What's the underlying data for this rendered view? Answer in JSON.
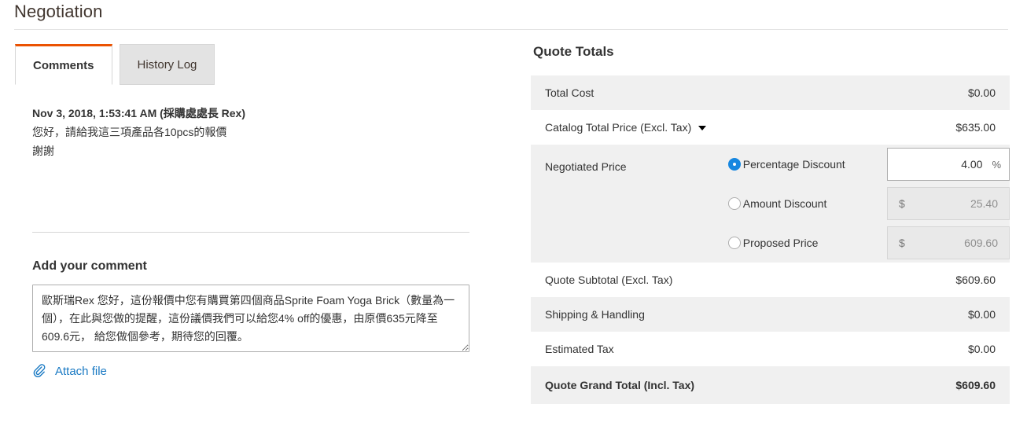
{
  "page": {
    "title": "Negotiation"
  },
  "tabs": [
    {
      "label": "Comments",
      "active": true
    },
    {
      "label": "History Log",
      "active": false
    }
  ],
  "comment": {
    "meta": "Nov 3, 2018, 1:53:41 AM (採購處處長 Rex)",
    "line1": "您好，請給我這三項產品各10pcs的報價",
    "line2": "謝謝"
  },
  "add_comment": {
    "heading": "Add your comment",
    "value": "歐斯瑞Rex 您好，這份報價中您有購買第四個商品Sprite Foam Yoga Brick（數量為一個），在此與您做的提醒，這份議價我們可以給您4% off的優惠，由原價635元降至609.6元， 給您做個參考，期待您的回覆。",
    "placeholder": "",
    "attach_label": "Attach file",
    "attach_icon": "paperclip-icon"
  },
  "totals": {
    "title": "Quote Totals",
    "rows": [
      {
        "label": "Total Cost",
        "value": "$0.00"
      },
      {
        "label": "Catalog Total Price (Excl. Tax)",
        "value": "$635.00",
        "caret": "chevron-down-icon"
      },
      {
        "label": "Quote Subtotal (Excl. Tax)",
        "value": "$609.60"
      },
      {
        "label": "Shipping & Handling",
        "value": "$0.00"
      },
      {
        "label": "Estimated Tax",
        "value": "$0.00"
      },
      {
        "label": "Quote Grand Total (Incl. Tax)",
        "value": "$609.60"
      }
    ],
    "negotiated": {
      "label": "Negotiated Price",
      "options": [
        {
          "label": "Percentage Discount",
          "selected": true,
          "value": "4.00",
          "suffix": "%"
        },
        {
          "label": "Amount Discount",
          "selected": false,
          "value": "25.40",
          "prefix": "$"
        },
        {
          "label": "Proposed Price",
          "selected": false,
          "value": "609.60",
          "prefix": "$"
        }
      ]
    }
  },
  "colors": {
    "accent_orange": "#eb5202",
    "link_blue": "#1979c3",
    "radio_blue": "#1787e0",
    "stripe_gray": "#f0f0f0",
    "tab_inactive_gray": "#e3e3e3"
  }
}
